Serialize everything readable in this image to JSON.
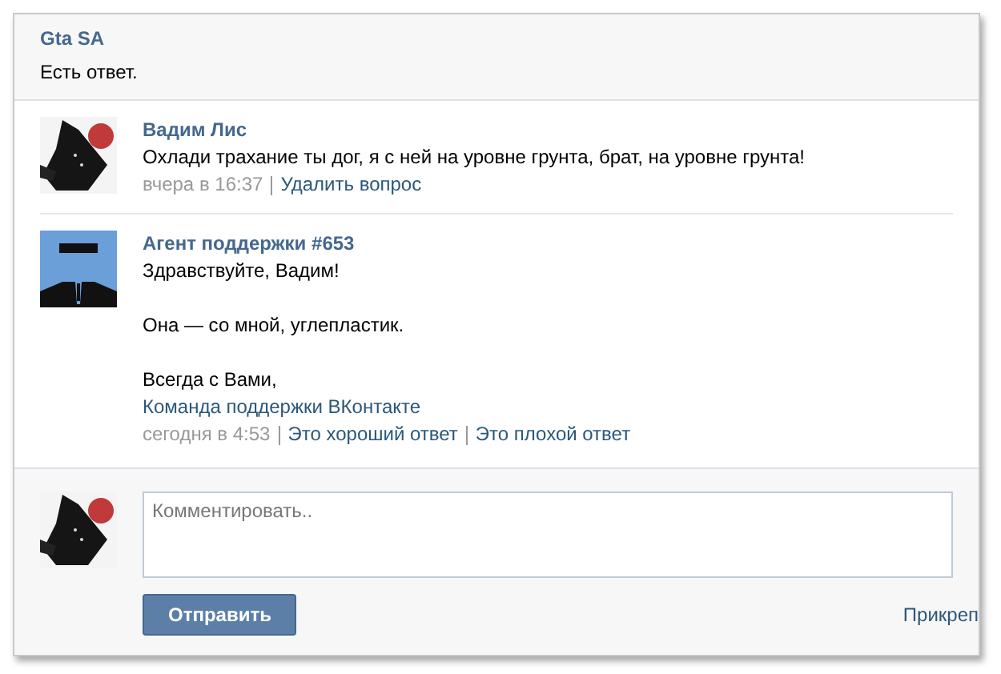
{
  "header": {
    "title": "Gta SA",
    "status": "Есть ответ."
  },
  "posts": [
    {
      "avatar": {
        "kind": "picture"
      },
      "author": "Вадим Лис",
      "paragraphs": [
        "Охлади трахание ты дог, я с ней на уровне грунта, брат, на уровне грунта!"
      ],
      "time": "вчера в 16:37",
      "actions": [
        "Удалить вопрос"
      ]
    },
    {
      "avatar": {
        "kind": "agent"
      },
      "author": "Агент поддержки #653",
      "paragraphs": [
        "Здравствуйте, Вадим!",
        "Она — со мной, углепластик.",
        "Всегда с Вами,"
      ],
      "signature": "Команда поддержки ВКонтакте",
      "time": "сегодня в 4:53",
      "actions": [
        "Это хороший ответ",
        "Это плохой ответ"
      ]
    }
  ],
  "composer": {
    "avatar": {
      "kind": "picture"
    },
    "placeholder": "Комментировать..",
    "send_button": "Отправить",
    "attach_link": "Прикреп"
  }
}
